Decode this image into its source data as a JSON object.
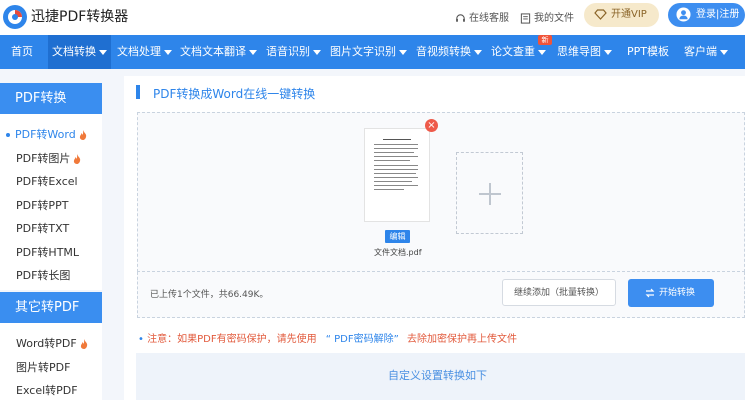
{
  "header": {
    "brand": "迅捷PDF转换器",
    "service_label": "在线客服",
    "files_label": "我的文件",
    "vip_label": "开通VIP",
    "login_label": "登录|注册"
  },
  "nav": {
    "items": [
      {
        "label": "首页"
      },
      {
        "label": "文档转换"
      },
      {
        "label": "文档处理"
      },
      {
        "label": "文档文本翻译"
      },
      {
        "label": "语音识别"
      },
      {
        "label": "图片文字识别"
      },
      {
        "label": "音视频转换"
      },
      {
        "label": "论文查重"
      },
      {
        "label": "思维导图"
      },
      {
        "label": "PPT模板"
      },
      {
        "label": "客户端"
      }
    ],
    "new_badge": "新"
  },
  "sidebar": {
    "section1_title": "PDF转换",
    "section1_items": [
      {
        "label": "PDF转Word"
      },
      {
        "label": "PDF转图片"
      },
      {
        "label": "PDF转Excel"
      },
      {
        "label": "PDF转PPT"
      },
      {
        "label": "PDF转TXT"
      },
      {
        "label": "PDF转HTML"
      },
      {
        "label": "PDF转长图"
      }
    ],
    "section2_title": "其它转PDF",
    "section2_items": [
      {
        "label": "Word转PDF"
      },
      {
        "label": "图片转PDF"
      },
      {
        "label": "Excel转PDF"
      }
    ]
  },
  "main": {
    "title": "PDF转换成Word在线一键转换",
    "file_name": "文件文档.pdf",
    "edit_label": "编辑",
    "upload_count": "已上传1个文件，共66.49K。",
    "continue_button": "继续添加（批量转换）",
    "start_button": "开始转换",
    "notice_text": "注意：如果PDF有密码保护，请先使用",
    "notice_link": "“ PDF密码解除”",
    "notice_tail": "去除加密保护再上传文件",
    "settings_label": "自定义设置转换如下"
  },
  "colors": {
    "accent": "#2e85ea",
    "nav_bg": "#2e85ea",
    "vip_bg": "#f6e9cb",
    "warning": "#e25a3c"
  }
}
